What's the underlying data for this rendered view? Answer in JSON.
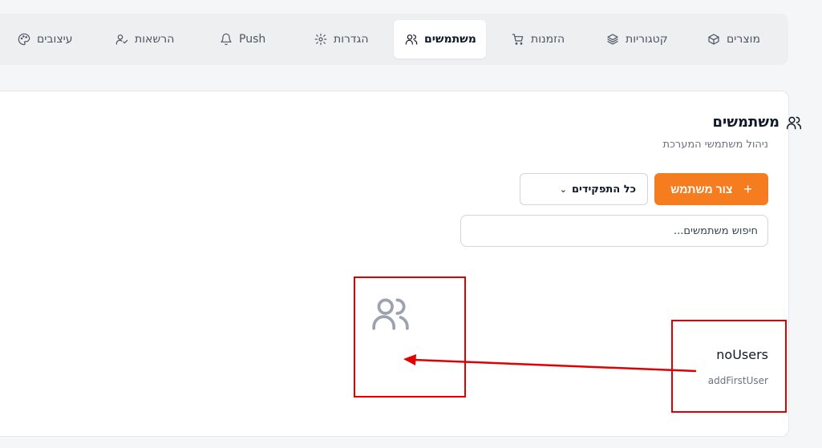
{
  "nav": {
    "tabs": [
      {
        "label": "מוצרים",
        "icon": "box-icon"
      },
      {
        "label": "קטגוריות",
        "icon": "layers-icon"
      },
      {
        "label": "הזמנות",
        "icon": "cart-icon"
      },
      {
        "label": "משתמשים",
        "icon": "users-icon",
        "active": true
      },
      {
        "label": "הגדרות",
        "icon": "gear-icon"
      },
      {
        "label": "Push",
        "icon": "bell-icon"
      },
      {
        "label": "הרשאות",
        "icon": "user-check-icon"
      },
      {
        "label": "עיצובים",
        "icon": "palette-icon"
      }
    ]
  },
  "section": {
    "title": "משתמשים",
    "subtitle": "ניהול משתמשי המערכת",
    "add_button": "צור משתמש",
    "add_icon": "+",
    "role_filter": "כל התפקידים",
    "search_placeholder": "חיפוש משתמשים..."
  },
  "empty_state": {
    "title": "noUsers",
    "subtitle": "addFirstUser"
  },
  "colors": {
    "accent": "#f57c1f",
    "annotation": "#e00000"
  }
}
